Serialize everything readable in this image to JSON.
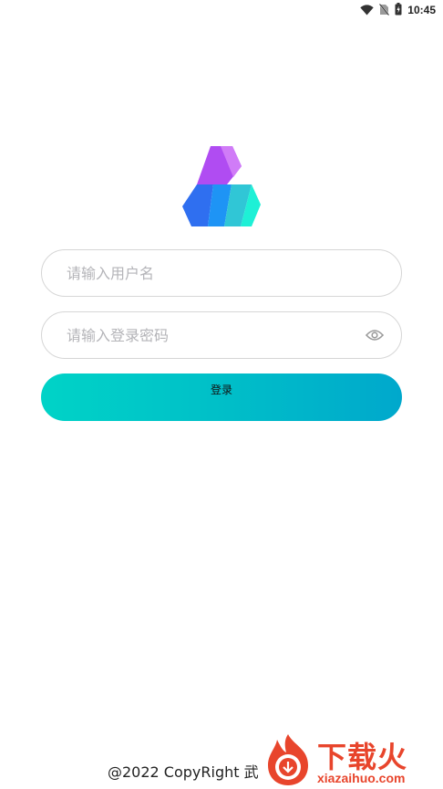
{
  "status_bar": {
    "time": "10:45",
    "icons": [
      "wifi-icon",
      "no-sim-icon",
      "battery-icon"
    ]
  },
  "logo": {
    "colors": {
      "purple": "#b04cf2",
      "violet": "#d07cf7",
      "blue": "#2f6ff0",
      "azure": "#1e94f5",
      "teal": "#30c6d6",
      "cyan": "#1ef0d6"
    }
  },
  "login_form": {
    "username_placeholder": "请输入用户名",
    "password_placeholder": "请输入登录密码",
    "password_toggle_icon": "eye-icon",
    "submit_label": "登录",
    "accent_gradient": [
      "#00d3c7",
      "#00a8cc"
    ]
  },
  "footer": {
    "copyright": "@2022 CopyRight 武"
  },
  "watermark": {
    "brand_cn": "下载火",
    "brand_url": "xiazaihuo.com",
    "color": "#e8452c"
  }
}
